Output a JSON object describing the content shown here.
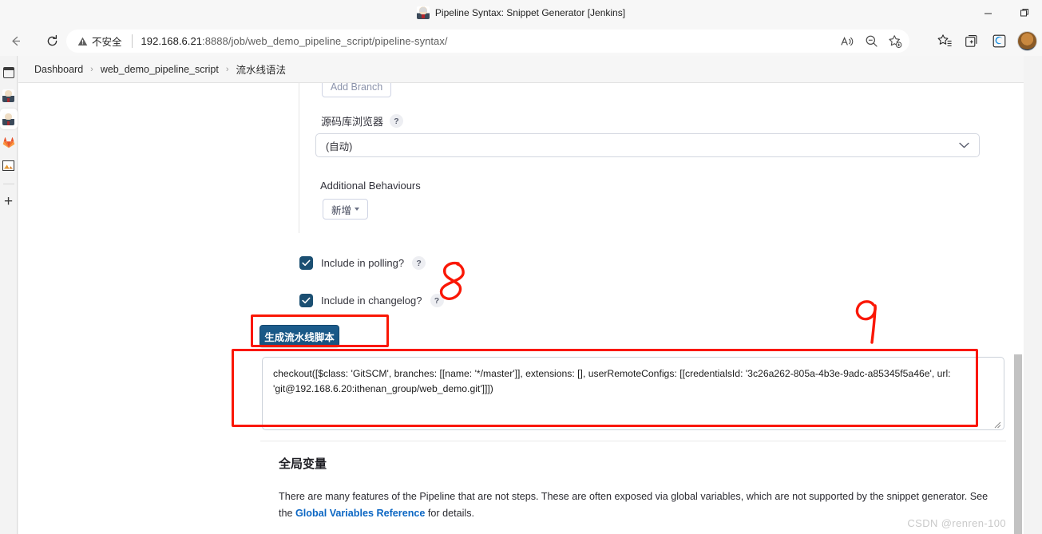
{
  "window": {
    "title": "Pipeline Syntax: Snippet Generator [Jenkins]",
    "favicon_name": "jenkins-butler-favicon",
    "minimize_label": "─",
    "restore_label": "❐",
    "close_label": "✕"
  },
  "toolbar": {
    "back_label": "←",
    "refresh_label": "⟳",
    "security_text": "不安全",
    "url_prefix": "192.168.6.21",
    "url_rest": ":8888/job/web_demo_pipeline_script/pipeline-syntax/",
    "url_full": "192.168.6.21:8888/job/web_demo_pipeline_script/pipeline-syntax/",
    "read_aloud_icon": "read-aloud-icon",
    "zoom_out_icon": "zoom-out-icon",
    "add_favorite_icon": "add-favorite-icon",
    "favorites_icon": "favorites-icon",
    "collections_icon": "collections-icon",
    "browser_essentials_icon": "browser-essentials-icon",
    "profile_icon": "profile-avatar"
  },
  "vertical_sidebar": {
    "items": [
      {
        "name": "panel-icon",
        "label": ""
      },
      {
        "name": "jenkins-icon-1",
        "label": ""
      },
      {
        "name": "jenkins-icon-2",
        "label": ""
      },
      {
        "name": "gitlab-icon",
        "label": ""
      },
      {
        "name": "image-icon",
        "label": ""
      }
    ],
    "add_label": "+"
  },
  "breadcrumb": {
    "items": [
      "Dashboard",
      "web_demo_pipeline_script",
      "流水线语法"
    ],
    "separator": "›"
  },
  "form": {
    "cut_off_button": "Add Branch",
    "repo_browser_label": "源码库浏览器",
    "help_badge": "?",
    "repo_browser_value": "(自动)",
    "additional_behaviours_label": "Additional Behaviours",
    "add_button_label": "新增",
    "checkboxes": [
      {
        "label": "Include in polling?",
        "checked": true
      },
      {
        "label": "Include in changelog?",
        "checked": true
      }
    ],
    "generate_button": "生成流水线脚本",
    "generated_script": "checkout([$class: 'GitSCM', branches: [[name: '*/master']], extensions: [], userRemoteConfigs: [[credentialsId: '3c26a262-805a-4b3e-9adc-a85345f5a46e', url: 'git@192.168.6.20:ithenan_group/web_demo.git']]])"
  },
  "globals": {
    "title": "全局变量",
    "paragraph_part1": "There are many features of the Pipeline that are not steps. These are often exposed via global variables, which are not supported by the snippet generator. See the ",
    "link_part1": "Global Variables",
    "link_part2": "Reference",
    "paragraph_part2": " for details."
  },
  "annotations": {
    "marker_8": "8",
    "marker_9": "9",
    "highlight_color": "#fa1705"
  },
  "watermark": "CSDN @renren-100"
}
